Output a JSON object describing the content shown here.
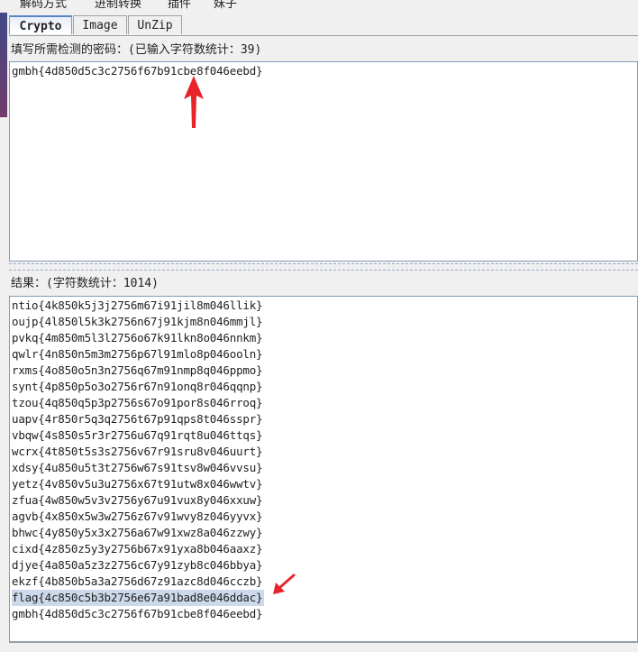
{
  "menu": {
    "items": [
      "解码方式",
      "进制转换",
      "插件",
      "妹子"
    ]
  },
  "tabs": [
    {
      "label": "Crypto",
      "active": true
    },
    {
      "label": "Image",
      "active": false
    },
    {
      "label": "UnZip",
      "active": false
    }
  ],
  "input": {
    "label": "填写所需检测的密码：(已输入字符数统计：39)",
    "value": "gmbh{4d850d5c3c2756f67b91cbe8f046eebd}"
  },
  "result": {
    "label": "结果：(字符数统计：1014)",
    "lines": [
      "ntio{4k850k5j3j2756m67i91jil8m046llik}",
      "oujp{4l850l5k3k2756n67j91kjm8n046mmjl}",
      "pvkq{4m850m5l3l2756o67k91lkn8o046nnkm}",
      "qwlr{4n850n5m3m2756p67l91mlo8p046ooln}",
      "rxms{4o850o5n3n2756q67m91nmp8q046ppmo}",
      "synt{4p850p5o3o2756r67n91onq8r046qqnp}",
      "tzou{4q850q5p3p2756s67o91por8s046rroq}",
      "uapv{4r850r5q3q2756t67p91qps8t046sspr}",
      "vbqw{4s850s5r3r2756u67q91rqt8u046ttqs}",
      "wcrx{4t850t5s3s2756v67r91sru8v046uurt}",
      "xdsy{4u850u5t3t2756w67s91tsv8w046vvsu}",
      "yetz{4v850v5u3u2756x67t91utw8x046wwtv}",
      "zfua{4w850w5v3v2756y67u91vux8y046xxuw}",
      "agvb{4x850x5w3w2756z67v91wvy8z046yyvx}",
      "bhwc{4y850y5x3x2756a67w91xwz8a046zzwy}",
      "cixd{4z850z5y3y2756b67x91yxa8b046aaxz}",
      "djye{4a850a5z3z2756c67y91zyb8c046bbya}",
      "ekzf{4b850b5a3a2756d67z91azc8d046cczb}",
      "flag{4c850c5b3b2756e67a91bad8e046ddac}",
      "gmbh{4d850d5c3c2756f67b91cbe8f046eebd}"
    ],
    "selected_index": 18
  },
  "colors": {
    "arrow": "#e8232a",
    "selection": "#cbd9ea",
    "border": "#7f9db9"
  }
}
